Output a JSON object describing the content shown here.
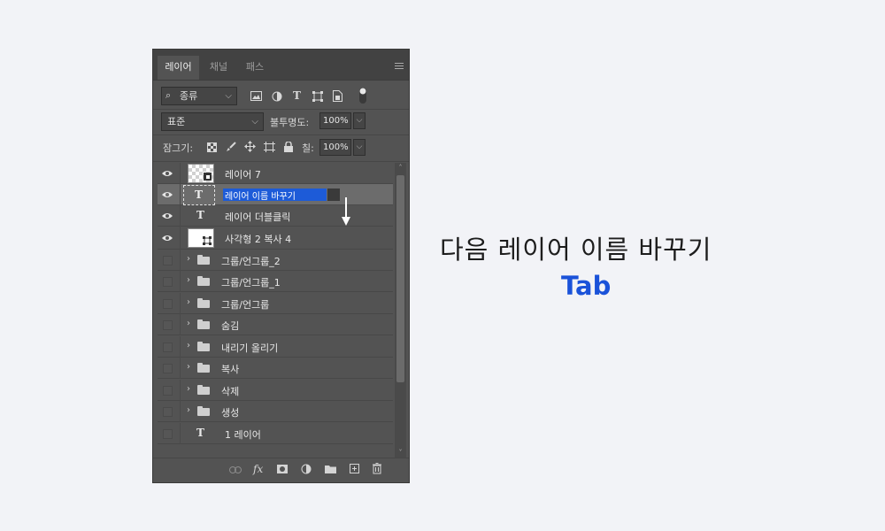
{
  "panel": {
    "tabs": [
      "레이어",
      "채널",
      "패스"
    ],
    "active_tab": "레이어",
    "filter": {
      "kind_label": "종류"
    },
    "blend": {
      "mode": "표준",
      "opacity_label": "불투명도:",
      "opacity_value": "100%"
    },
    "lock": {
      "label": "잠그기:",
      "fill_label": "칠:",
      "fill_value": "100%"
    },
    "layers": [
      {
        "name": "레이어 7",
        "kind": "pixel",
        "visible": true
      },
      {
        "name": "레이어 이름 바꾸기",
        "kind": "text",
        "visible": true,
        "selected": true,
        "editing": true
      },
      {
        "name": "레이어 더블클릭",
        "kind": "text",
        "visible": true
      },
      {
        "name": "사각형 2 복사 4",
        "kind": "shape",
        "visible": true
      },
      {
        "name": "그룹/언그룹_2",
        "kind": "group",
        "visible": false
      },
      {
        "name": "그룹/언그룹_1",
        "kind": "group",
        "visible": false
      },
      {
        "name": "그룹/언그룹",
        "kind": "group",
        "visible": false
      },
      {
        "name": "숨김",
        "kind": "group",
        "visible": false
      },
      {
        "name": "내리기 올리기",
        "kind": "group",
        "visible": false
      },
      {
        "name": "복사",
        "kind": "group",
        "visible": false
      },
      {
        "name": "삭제",
        "kind": "group",
        "visible": false
      },
      {
        "name": "생성",
        "kind": "group",
        "visible": false
      },
      {
        "name": "1 레이어",
        "kind": "text",
        "visible": false
      }
    ],
    "footer_icons": [
      "link-icon",
      "fx-icon",
      "mask-icon",
      "adjustment-icon",
      "folder-icon",
      "new-layer-icon",
      "trash-icon"
    ],
    "footer_fx": "fx"
  },
  "instruction": {
    "headline": "다음 레이어 이름 바꾸기",
    "key": "Tab",
    "key_color": "#1a52d9"
  }
}
